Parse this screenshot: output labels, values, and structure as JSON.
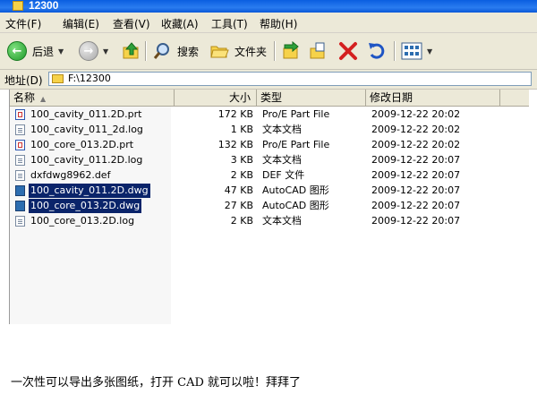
{
  "window": {
    "title": "12300"
  },
  "menu": [
    "文件(F)",
    "编辑(E)",
    "查看(V)",
    "收藏(A)",
    "工具(T)",
    "帮助(H)"
  ],
  "toolbar": {
    "back_label": "后退",
    "search_label": "搜索",
    "folders_label": "文件夹"
  },
  "address": {
    "label": "地址(D)",
    "path": "F:\\12300"
  },
  "columns": {
    "name": "名称",
    "size": "大小",
    "type": "类型",
    "date": "修改日期"
  },
  "files": [
    {
      "name": "100_cavity_011.2D.prt",
      "size": "172 KB",
      "type": "Pro/E Part File",
      "date": "2009-12-22 20:02",
      "icon": "prt-file-icon",
      "selected": false
    },
    {
      "name": "100_cavity_011_2d.log",
      "size": "1 KB",
      "type": "文本文档",
      "date": "2009-12-22 20:02",
      "icon": "text-file-icon",
      "selected": false
    },
    {
      "name": "100_core_013.2D.prt",
      "size": "132 KB",
      "type": "Pro/E Part File",
      "date": "2009-12-22 20:02",
      "icon": "prt-file-icon",
      "selected": false
    },
    {
      "name": "100_cavity_011.2D.log",
      "size": "3 KB",
      "type": "文本文档",
      "date": "2009-12-22 20:07",
      "icon": "text-file-icon",
      "selected": false
    },
    {
      "name": "dxfdwg8962.def",
      "size": "2 KB",
      "type": "DEF 文件",
      "date": "2009-12-22 20:07",
      "icon": "text-file-icon",
      "selected": false
    },
    {
      "name": "100_cavity_011.2D.dwg",
      "size": "47 KB",
      "type": "AutoCAD 图形",
      "date": "2009-12-22 20:07",
      "icon": "dwg-file-icon",
      "selected": true
    },
    {
      "name": "100_core_013.2D.dwg",
      "size": "27 KB",
      "type": "AutoCAD 图形",
      "date": "2009-12-22 20:07",
      "icon": "dwg-file-icon",
      "selected": true
    },
    {
      "name": "100_core_013.2D.log",
      "size": "2 KB",
      "type": "文本文档",
      "date": "2009-12-22 20:07",
      "icon": "text-file-icon",
      "selected": false
    }
  ],
  "caption": "一次性可以导出多张图纸，打开 CAD 就可以啦！拜拜了",
  "colors": {
    "titlebar": "#0a5ee0",
    "selection": "#0a246a",
    "chrome": "#ece9d8"
  }
}
